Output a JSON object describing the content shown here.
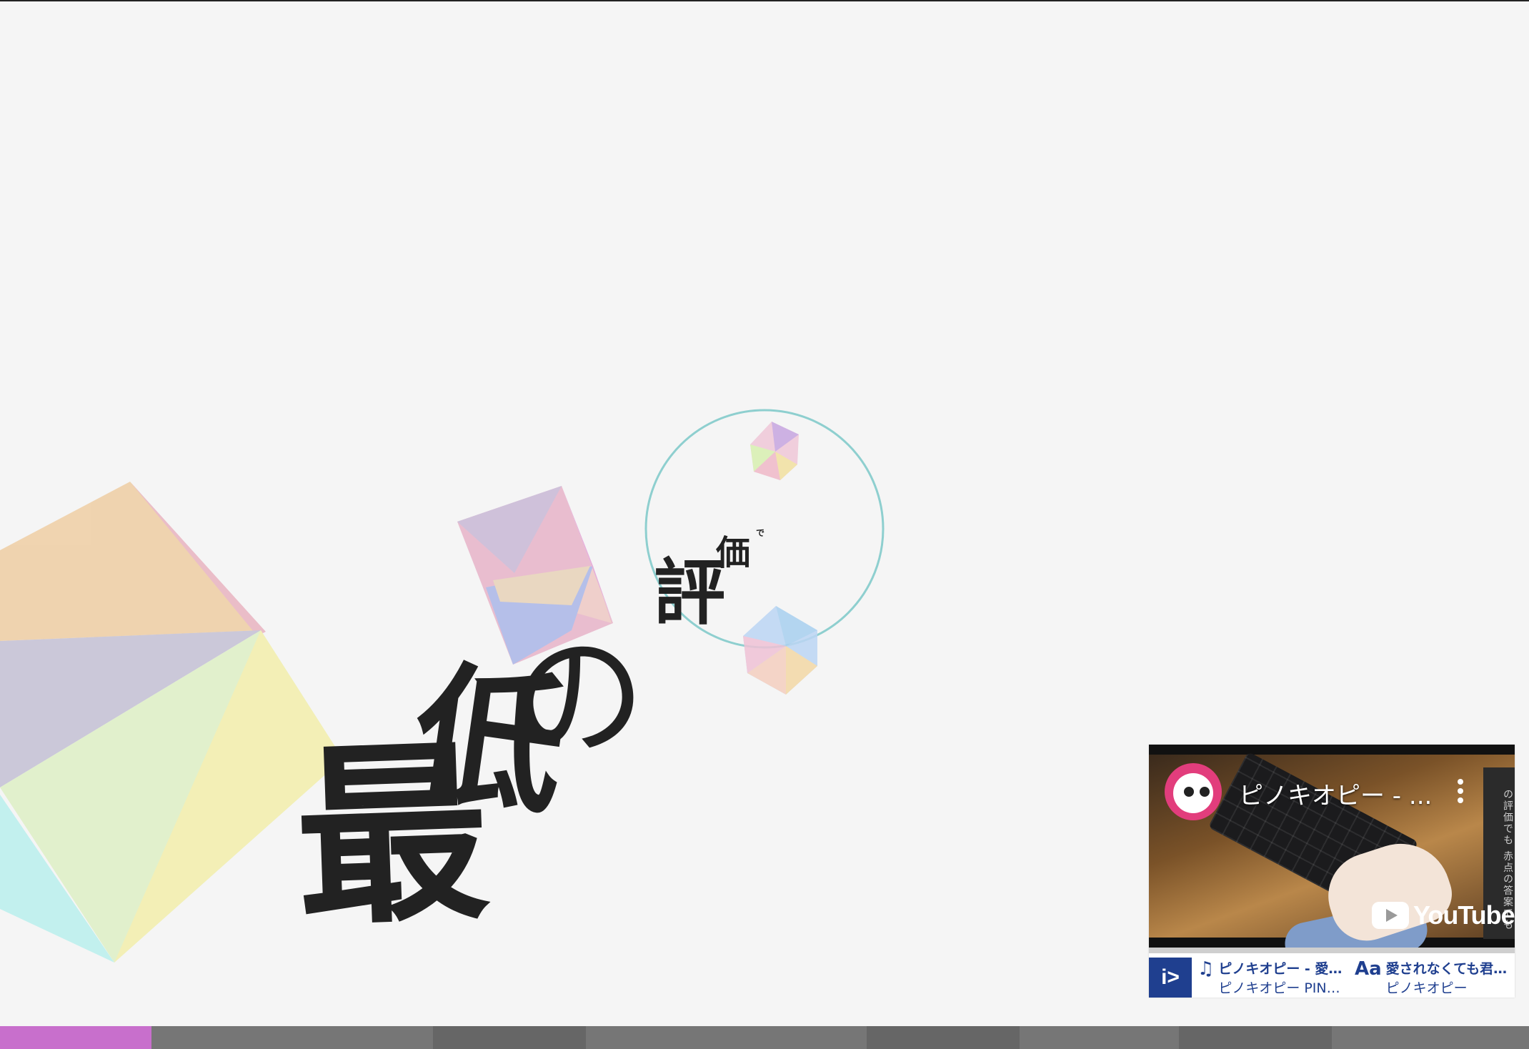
{
  "lyrics": {
    "ka": "評",
    "ka2": "価",
    "de": "で",
    "no": "の",
    "tei": "低",
    "sai": "最"
  },
  "player": {
    "video_title": "ピノキオピー - ...",
    "youtube_logo_text": "YouTube",
    "side_text": "の評価でも 赤点の答案でも",
    "app_logo_text": "i>",
    "song": {
      "icon": "music-note-icon",
      "title": "ピノキオピー - 愛…",
      "artist": "ピノキオピー PIN…"
    },
    "lyrics_info": {
      "icon": "font-aa-icon",
      "title": "愛されなくても君…",
      "artist": "ピノキオピー"
    }
  },
  "chapter_bar": {
    "segments": [
      {
        "fraction": 0.099,
        "color": "#c86fcc"
      },
      {
        "fraction": 0.184,
        "color": "#767676"
      },
      {
        "fraction": 0.1,
        "color": "#666666"
      },
      {
        "fraction": 0.184,
        "color": "#767676"
      },
      {
        "fraction": 0.1,
        "color": "#666666"
      },
      {
        "fraction": 0.104,
        "color": "#767676"
      },
      {
        "fraction": 0.1,
        "color": "#666666"
      },
      {
        "fraction": 0.129,
        "color": "#767676"
      }
    ]
  },
  "colors": {
    "background": "#f5f5f5",
    "text": "#222222",
    "circle": "#8ecfcf",
    "brand_blue": "#1f3f8f",
    "progress_active": "#c86fcc"
  }
}
